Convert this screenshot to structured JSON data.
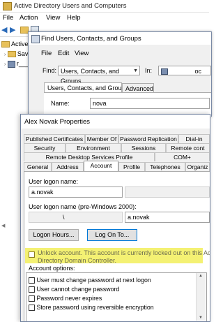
{
  "aduc": {
    "title": "Active Directory Users and Computers",
    "menu": [
      "File",
      "Action",
      "View",
      "Help"
    ],
    "tree": [
      "Active D",
      "Saved",
      "r___.n"
    ]
  },
  "find": {
    "title": "Find Users, Contacts, and Groups",
    "menu": [
      "File",
      "Edit",
      "View"
    ],
    "find_label": "Find:",
    "find_value": "Users, Contacts, and Groups",
    "in_label": "In:",
    "in_value": "oc",
    "tabs": [
      "Users, Contacts, and Groups",
      "Advanced"
    ],
    "name_label": "Name:",
    "name_value": "nova"
  },
  "props": {
    "title": "Alex Novak Properties",
    "tabs_row1": [
      "Published Certificates",
      "Member Of",
      "Password Replication",
      "Dial-in"
    ],
    "tabs_row2": [
      "Security",
      "Environment",
      "Sessions",
      "Remote cont"
    ],
    "tabs_row3": [
      "Remote Desktop Services Profile",
      "COM+"
    ],
    "tabs_row4": [
      "General",
      "Address",
      "Account",
      "Profile",
      "Telephones",
      "Organiz"
    ],
    "logon_label": "User logon name:",
    "logon_value": "a.novak",
    "pre2000_label": "User logon name (pre-Windows 2000):",
    "pre2000_domain": "\\",
    "pre2000_value": "a.novak",
    "logon_hours_btn": "Logon Hours...",
    "logon_to_btn": "Log On To...",
    "unlock_line1": "Unlock account. This account is currently locked out on this Active",
    "unlock_line2": "Directory Domain Controller.",
    "options_label": "Account options:",
    "options": [
      "User must change password at next logon",
      "User cannot change password",
      "Password never expires",
      "Store password using reversible encryption"
    ]
  },
  "colors": {
    "highlight": "#f2ee5a",
    "focus": "#0078d7"
  }
}
